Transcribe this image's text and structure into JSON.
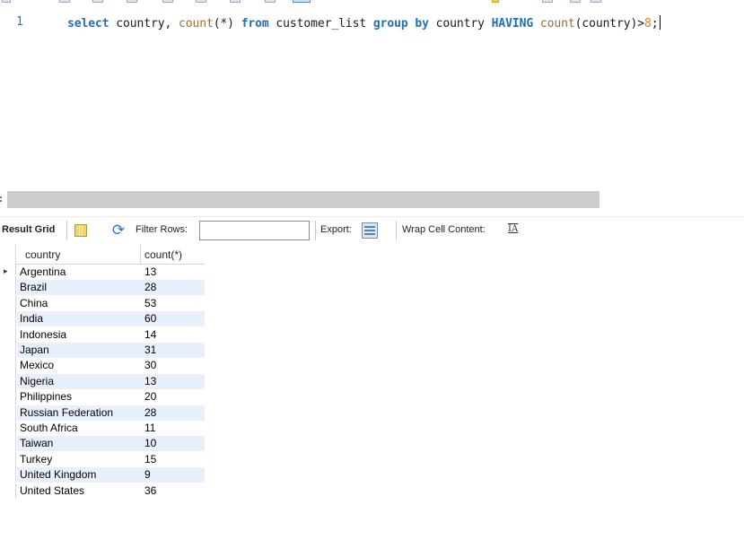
{
  "editor": {
    "line_number": "1",
    "tokens": [
      {
        "t": "select",
        "c": "kw"
      },
      {
        "t": " country, ",
        "c": ""
      },
      {
        "t": "count",
        "c": "fn"
      },
      {
        "t": "(*) ",
        "c": ""
      },
      {
        "t": "from",
        "c": "kw"
      },
      {
        "t": " customer_list ",
        "c": ""
      },
      {
        "t": "group",
        "c": "kw"
      },
      {
        "t": " ",
        "c": ""
      },
      {
        "t": "by",
        "c": "kw"
      },
      {
        "t": " country ",
        "c": ""
      },
      {
        "t": "HAVING",
        "c": "kw"
      },
      {
        "t": " ",
        "c": ""
      },
      {
        "t": "count",
        "c": "fn"
      },
      {
        "t": "(country)>",
        "c": ""
      },
      {
        "t": "8",
        "c": "num"
      },
      {
        "t": ";",
        "c": ""
      }
    ]
  },
  "result_toolbar": {
    "result_grid_label": "Result Grid",
    "filter_rows_label": "Filter Rows:",
    "filter_value": "",
    "export_label": "Export:",
    "wrap_label": "Wrap Cell Content:",
    "wrap_icon_text": "IA"
  },
  "grid": {
    "columns": [
      "country",
      "count(*)"
    ],
    "rows": [
      [
        "Argentina",
        "13"
      ],
      [
        "Brazil",
        "28"
      ],
      [
        "China",
        "53"
      ],
      [
        "India",
        "60"
      ],
      [
        "Indonesia",
        "14"
      ],
      [
        "Japan",
        "31"
      ],
      [
        "Mexico",
        "30"
      ],
      [
        "Nigeria",
        "13"
      ],
      [
        "Philippines",
        "20"
      ],
      [
        "Russian Federation",
        "28"
      ],
      [
        "South Africa",
        "11"
      ],
      [
        "Taiwan",
        "10"
      ],
      [
        "Turkey",
        "15"
      ],
      [
        "United Kingdom",
        "9"
      ],
      [
        "United States",
        "36"
      ]
    ]
  }
}
